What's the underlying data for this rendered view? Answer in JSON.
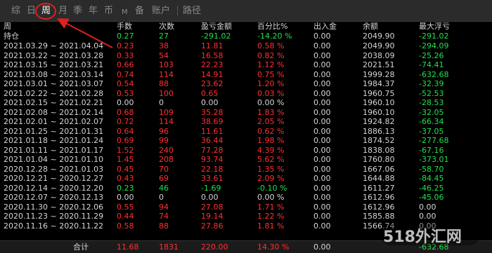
{
  "tabs": [
    "综",
    "日",
    "周",
    "月",
    "季",
    "年",
    "币",
    "M",
    "备",
    "账户",
    "路径"
  ],
  "columns": {
    "period": "周",
    "lots": "手数",
    "count": "次数",
    "pnl": "盈亏金额",
    "pct": "百分比%",
    "cashflow": "出入金",
    "balance": "余额",
    "maxfloat": "最大浮亏"
  },
  "holding": {
    "label": "持仓",
    "lots": "0.27",
    "count": "27",
    "pnl": "-291.02",
    "pct": "-14.20 %",
    "cashflow": "0.00",
    "balance": "2049.90",
    "maxfloat": "-291.02"
  },
  "rows": [
    {
      "period": "2021.03.29 ~ 2021.04.04",
      "lots": "0.23",
      "count": "38",
      "pnl": "11.81",
      "pct": "0.58 %",
      "cashflow": "0.00",
      "balance": "2049.90",
      "maxfloat": "-294.09",
      "tone": "red"
    },
    {
      "period": "2021.03.22 ~ 2021.03.28",
      "lots": "0.33",
      "count": "54",
      "pnl": "16.58",
      "pct": "0.82 %",
      "cashflow": "0.00",
      "balance": "2038.09",
      "maxfloat": "-25.26",
      "tone": "red"
    },
    {
      "period": "2021.03.15 ~ 2021.03.21",
      "lots": "0.66",
      "count": "103",
      "pnl": "22.23",
      "pct": "1.12 %",
      "cashflow": "0.00",
      "balance": "2021.51",
      "maxfloat": "-74.41",
      "tone": "red"
    },
    {
      "period": "2021.03.08 ~ 2021.03.14",
      "lots": "0.74",
      "count": "114",
      "pnl": "14.91",
      "pct": "0.75 %",
      "cashflow": "0.00",
      "balance": "1999.28",
      "maxfloat": "-632.68",
      "tone": "red"
    },
    {
      "period": "2021.03.01 ~ 2021.03.07",
      "lots": "0.54",
      "count": "88",
      "pnl": "23.62",
      "pct": "1.20 %",
      "cashflow": "0.00",
      "balance": "1984.37",
      "maxfloat": "-32.39",
      "tone": "red"
    },
    {
      "period": "2021.02.22 ~ 2021.02.28",
      "lots": "0.53",
      "count": "100",
      "pnl": "0.65",
      "pct": "0.03 %",
      "cashflow": "0.00",
      "balance": "1960.75",
      "maxfloat": "-52.53",
      "tone": "red"
    },
    {
      "period": "2021.02.15 ~ 2021.02.21",
      "lots": "0.00",
      "count": "0",
      "pnl": "0.00",
      "pct": "0.00 %",
      "cashflow": "0.00",
      "balance": "1960.10",
      "maxfloat": "-28.53",
      "tone": "neutral"
    },
    {
      "period": "2021.02.08 ~ 2021.02.14",
      "lots": "0.68",
      "count": "109",
      "pnl": "35.28",
      "pct": "1.83 %",
      "cashflow": "0.00",
      "balance": "1960.10",
      "maxfloat": "-32.05",
      "tone": "red"
    },
    {
      "period": "2021.02.01 ~ 2021.02.07",
      "lots": "0.72",
      "count": "114",
      "pnl": "38.69",
      "pct": "2.05 %",
      "cashflow": "0.00",
      "balance": "1924.82",
      "maxfloat": "-66.34",
      "tone": "red"
    },
    {
      "period": "2021.01.25 ~ 2021.01.31",
      "lots": "0.64",
      "count": "96",
      "pnl": "11.61",
      "pct": "0.62 %",
      "cashflow": "0.00",
      "balance": "1886.13",
      "maxfloat": "-37.05",
      "tone": "red"
    },
    {
      "period": "2021.01.18 ~ 2021.01.24",
      "lots": "0.69",
      "count": "99",
      "pnl": "36.44",
      "pct": "1.98 %",
      "cashflow": "0.00",
      "balance": "1874.52",
      "maxfloat": "-277.68",
      "tone": "red"
    },
    {
      "period": "2021.01.11 ~ 2021.01.17",
      "lots": "1.52",
      "count": "240",
      "pnl": "77.28",
      "pct": "4.39 %",
      "cashflow": "0.00",
      "balance": "1838.08",
      "maxfloat": "-67.16",
      "tone": "red"
    },
    {
      "period": "2021.01.04 ~ 2021.01.10",
      "lots": "1.45",
      "count": "208",
      "pnl": "93.74",
      "pct": "5.62 %",
      "cashflow": "0.00",
      "balance": "1760.80",
      "maxfloat": "-373.01",
      "tone": "red"
    },
    {
      "period": "2020.12.28 ~ 2021.01.03",
      "lots": "0.45",
      "count": "70",
      "pnl": "22.18",
      "pct": "1.35 %",
      "cashflow": "0.00",
      "balance": "1667.06",
      "maxfloat": "-58.70",
      "tone": "red"
    },
    {
      "period": "2020.12.21 ~ 2020.12.27",
      "lots": "0.43",
      "count": "69",
      "pnl": "33.61",
      "pct": "2.09 %",
      "cashflow": "0.00",
      "balance": "1644.88",
      "maxfloat": "-84.45",
      "tone": "red"
    },
    {
      "period": "2020.12.14 ~ 2020.12.20",
      "lots": "0.23",
      "count": "46",
      "pnl": "-1.69",
      "pct": "-0.10 %",
      "cashflow": "0.00",
      "balance": "1611.27",
      "maxfloat": "-46.25",
      "tone": "green"
    },
    {
      "period": "2020.12.07 ~ 2020.12.13",
      "lots": "0.00",
      "count": "0",
      "pnl": "0.00",
      "pct": "0.00 %",
      "cashflow": "0.00",
      "balance": "1612.96",
      "maxfloat": "-45.06",
      "tone": "neutral"
    },
    {
      "period": "2020.11.30 ~ 2020.12.06",
      "lots": "0.55",
      "count": "94",
      "pnl": "27.08",
      "pct": "1.71 %",
      "cashflow": "0.00",
      "balance": "1612.96",
      "maxfloat": "0.00",
      "tone": "red"
    },
    {
      "period": "2020.11.23 ~ 2020.11.29",
      "lots": "0.44",
      "count": "74",
      "pnl": "19.14",
      "pct": "1.22 %",
      "cashflow": "0.00",
      "balance": "1585.88",
      "maxfloat": "0.00",
      "tone": "red"
    },
    {
      "period": "2020.11.16 ~ 2020.11.22",
      "lots": "0.58",
      "count": "88",
      "pnl": "27.86",
      "pct": "1.81 %",
      "cashflow": "0.00",
      "balance": "1566.74",
      "maxfloat": "0.00",
      "tone": "red"
    }
  ],
  "footer": {
    "label": "合计",
    "lots": "11.68",
    "count": "1831",
    "pnl": "220.00",
    "pct": "14.30 %",
    "cashflow": "0.00",
    "maxfloat": "-632.68"
  },
  "watermark": "518外汇网",
  "colors": {
    "profit": "#ff3030",
    "loss": "#22e14a",
    "neutral": "#d6d6d6",
    "annotation": "#e0201f"
  }
}
